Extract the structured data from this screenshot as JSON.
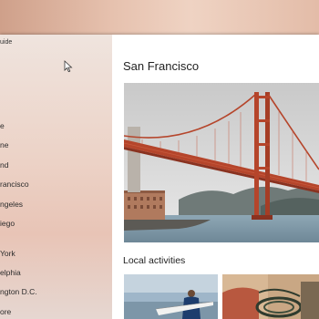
{
  "app": {
    "title": "uide"
  },
  "sidebar": {
    "items": [
      {
        "label": "e"
      },
      {
        "label": "ne"
      },
      {
        "label": "nd"
      },
      {
        "label": "rancisco"
      },
      {
        "label": "ngeles"
      },
      {
        "label": "iego"
      },
      {
        "label": "York"
      },
      {
        "label": "elphia"
      },
      {
        "label": "ngton D.C."
      },
      {
        "label": "ore"
      }
    ]
  },
  "main": {
    "city_title": "San Francisco",
    "hero_alt": "Golden Gate Bridge",
    "local_activities_title": "Local activities",
    "activities": [
      {
        "icon": "surfer-photo"
      },
      {
        "icon": "boat-rigging-photo"
      }
    ]
  },
  "colors": {
    "accent_bridge": "#b5452b",
    "sidebar_tint": "#ecd2c6"
  }
}
